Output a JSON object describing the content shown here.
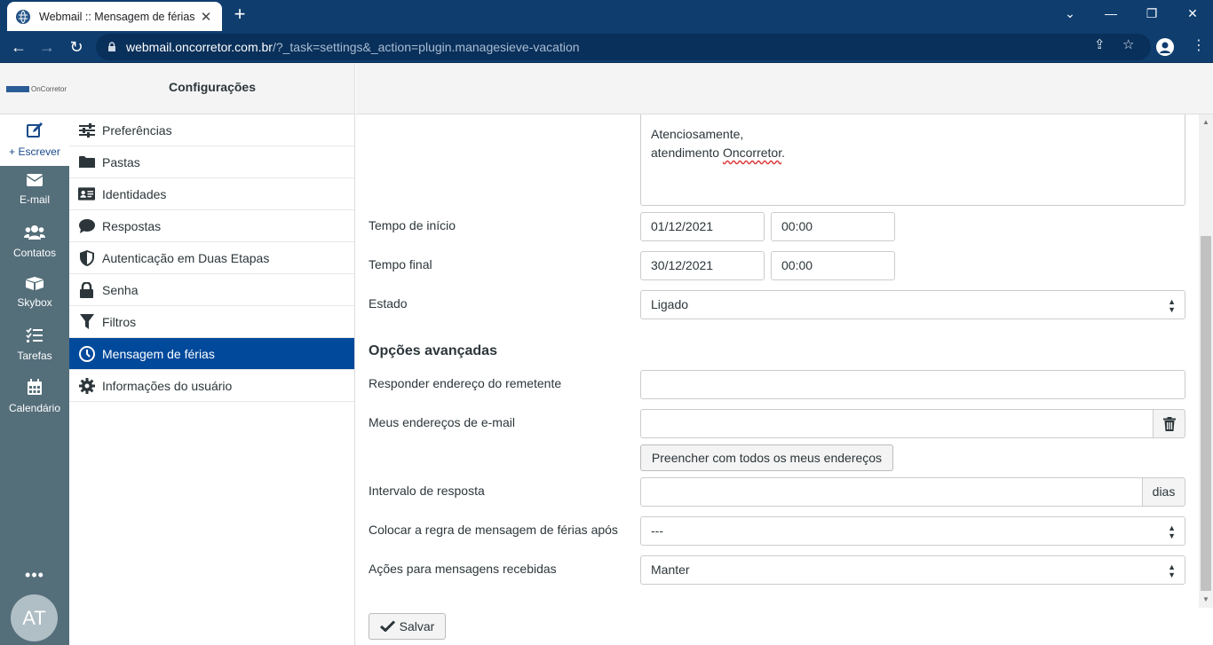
{
  "browser": {
    "tab_title": "Webmail :: Mensagem de férias",
    "url_host": "webmail.oncorretor.com.br",
    "url_path": "/?_task=settings&_action=plugin.managesieve-vacation"
  },
  "app": {
    "logo_text": "OnCorretor",
    "header_title": "Configurações"
  },
  "taskbar": {
    "compose": "+ Escrever",
    "mail": "E-mail",
    "contacts": "Contatos",
    "skybox": "Skybox",
    "tasks": "Tarefas",
    "calendar": "Calendário",
    "more": "•••",
    "avatar": "AT"
  },
  "settings": {
    "items": [
      {
        "label": "Preferências",
        "icon": "sliders-icon"
      },
      {
        "label": "Pastas",
        "icon": "folder-icon"
      },
      {
        "label": "Identidades",
        "icon": "id-card-icon"
      },
      {
        "label": "Respostas",
        "icon": "comment-icon"
      },
      {
        "label": "Autenticação em Duas Etapas",
        "icon": "shield-icon"
      },
      {
        "label": "Senha",
        "icon": "lock-icon"
      },
      {
        "label": "Filtros",
        "icon": "filter-icon"
      },
      {
        "label": "Mensagem de férias",
        "icon": "clock-icon"
      },
      {
        "label": "Informações do usuário",
        "icon": "gear-icon"
      }
    ]
  },
  "form": {
    "body_line1": "Atenciosamente,",
    "body_line2_pre": "atendimento ",
    "body_line2_word": "Oncorretor",
    "body_line2_post": ".",
    "start_label": "Tempo de início",
    "start_date": "01/12/2021",
    "start_time": "00:00",
    "end_label": "Tempo final",
    "end_date": "30/12/2021",
    "end_time": "00:00",
    "status_label": "Estado",
    "status_value": "Ligado",
    "advanced_title": "Opções avançadas",
    "reply_sender_label": "Responder endereço do remetente",
    "my_addresses_label": "Meus endereços de e-mail",
    "fill_all_button": "Preencher com todos os meus endereços",
    "interval_label": "Intervalo de resposta",
    "interval_unit": "dias",
    "place_after_label": "Colocar a regra de mensagem de férias após",
    "place_after_value": "---",
    "incoming_action_label": "Ações para mensagens recebidas",
    "incoming_action_value": "Manter",
    "save_button": "Salvar"
  }
}
